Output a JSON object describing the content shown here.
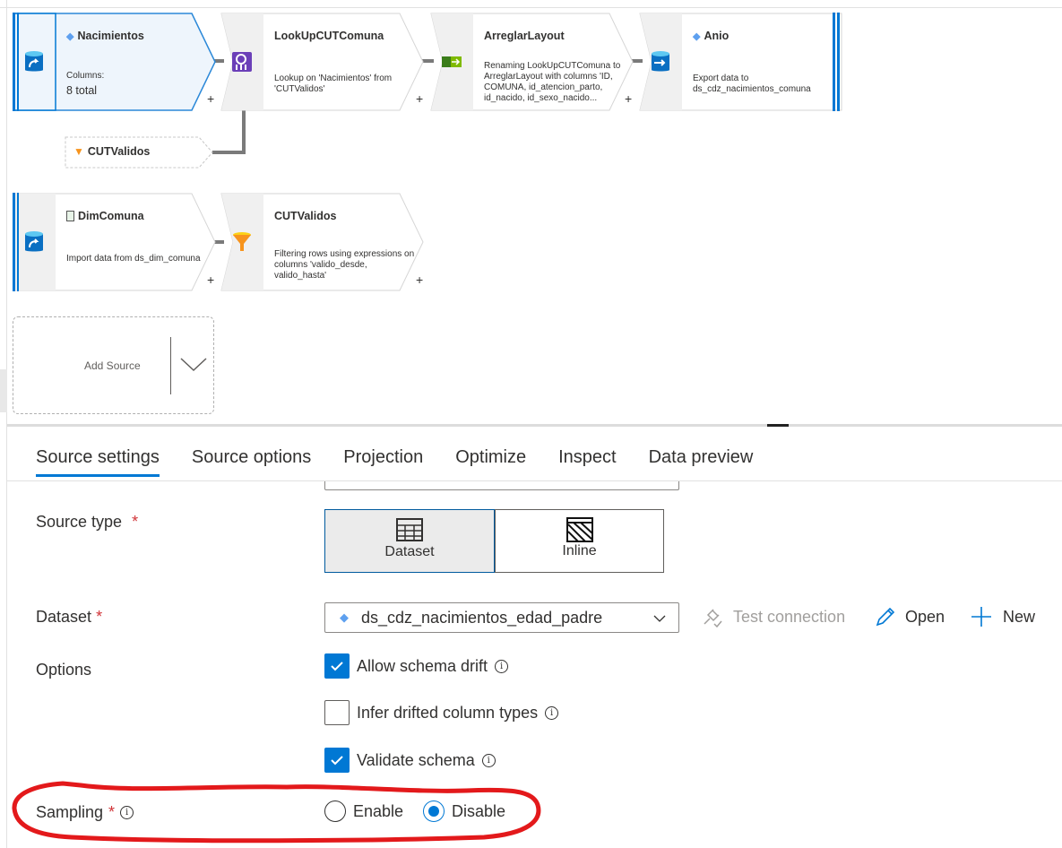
{
  "canvas": {
    "nodes": [
      {
        "title": "Nacimientos",
        "desc_label": "Columns:",
        "desc_value": "8 total",
        "icon": "source-database-icon",
        "title_icon": "dataset-icon"
      },
      {
        "title": "LookUpCUTComuna",
        "desc": "Lookup on 'Nacimientos' from 'CUTValidos'",
        "icon": "lookup-icon"
      },
      {
        "title": "ArreglarLayout",
        "desc": "Renaming LookUpCUTComuna to ArreglarLayout with columns 'ID, COMUNA, id_atencion_parto, id_nacido, id_sexo_nacido...",
        "icon": "select-icon"
      },
      {
        "title": "Anio",
        "desc": "Export data to ds_cdz_nacimientos_comuna",
        "icon": "sink-database-icon",
        "title_icon": "dataset-icon"
      },
      {
        "title": "DimComuna",
        "desc": "Import data from ds_dim_comuna",
        "icon": "source-database-icon",
        "title_icon": "csv-file-icon"
      },
      {
        "title": "CUTValidos",
        "desc": "Filtering rows using expressions on columns 'valido_desde, valido_hasta'",
        "icon": "filter-icon"
      }
    ],
    "reference_node": {
      "title": "CUTValidos",
      "icon": "filter-icon"
    },
    "add_source": {
      "label": "Add Source"
    },
    "plus": "+"
  },
  "tabs": [
    {
      "label": "Source settings",
      "active": true
    },
    {
      "label": "Source options"
    },
    {
      "label": "Projection"
    },
    {
      "label": "Optimize"
    },
    {
      "label": "Inspect"
    },
    {
      "label": "Data preview"
    }
  ],
  "form": {
    "required_mark": "*",
    "source_type": {
      "label": "Source type",
      "options": [
        "Dataset",
        "Inline"
      ],
      "selected": "Dataset"
    },
    "dataset": {
      "label": "Dataset",
      "value": "ds_cdz_nacimientos_edad_padre",
      "test_connection": "Test connection",
      "open": "Open",
      "new": "New"
    },
    "options": {
      "label": "Options",
      "items": [
        {
          "label": "Allow schema drift",
          "checked": true
        },
        {
          "label": "Infer drifted column types",
          "checked": false
        },
        {
          "label": "Validate schema",
          "checked": true
        }
      ]
    },
    "sampling": {
      "label": "Sampling",
      "options": [
        "Enable",
        "Disable"
      ],
      "selected": "Disable"
    },
    "info_glyph": "i"
  },
  "colors": {
    "accent": "#0078d4",
    "annotation": "#e3191b",
    "selected_node_bg": "#eef5fc"
  }
}
